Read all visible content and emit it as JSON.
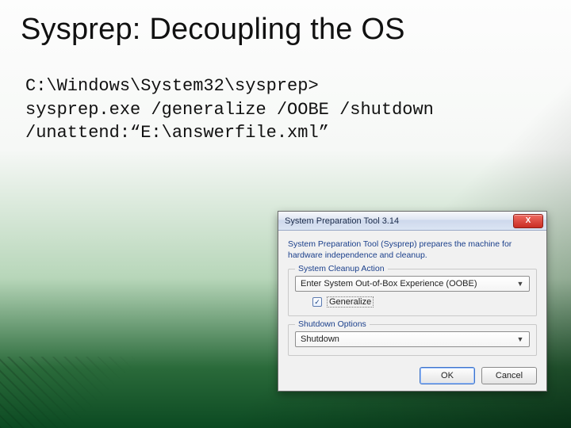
{
  "slide": {
    "title": "Sysprep: Decoupling the OS",
    "code": "C:\\Windows\\System32\\sysprep>\nsysprep.exe /generalize /OOBE /shutdown\n/unattend:“E:\\answerfile.xml”"
  },
  "dialog": {
    "caption": "System Preparation Tool 3.14",
    "description": "System Preparation Tool (Sysprep) prepares the machine for hardware independence and cleanup.",
    "cleanup": {
      "group_label": "System Cleanup Action",
      "selected": "Enter System Out-of-Box Experience (OOBE)",
      "generalize_label": "Generalize",
      "generalize_checked": true
    },
    "shutdown": {
      "group_label": "Shutdown Options",
      "selected": "Shutdown"
    },
    "buttons": {
      "ok": "OK",
      "cancel": "Cancel"
    },
    "close_glyph": "X"
  }
}
